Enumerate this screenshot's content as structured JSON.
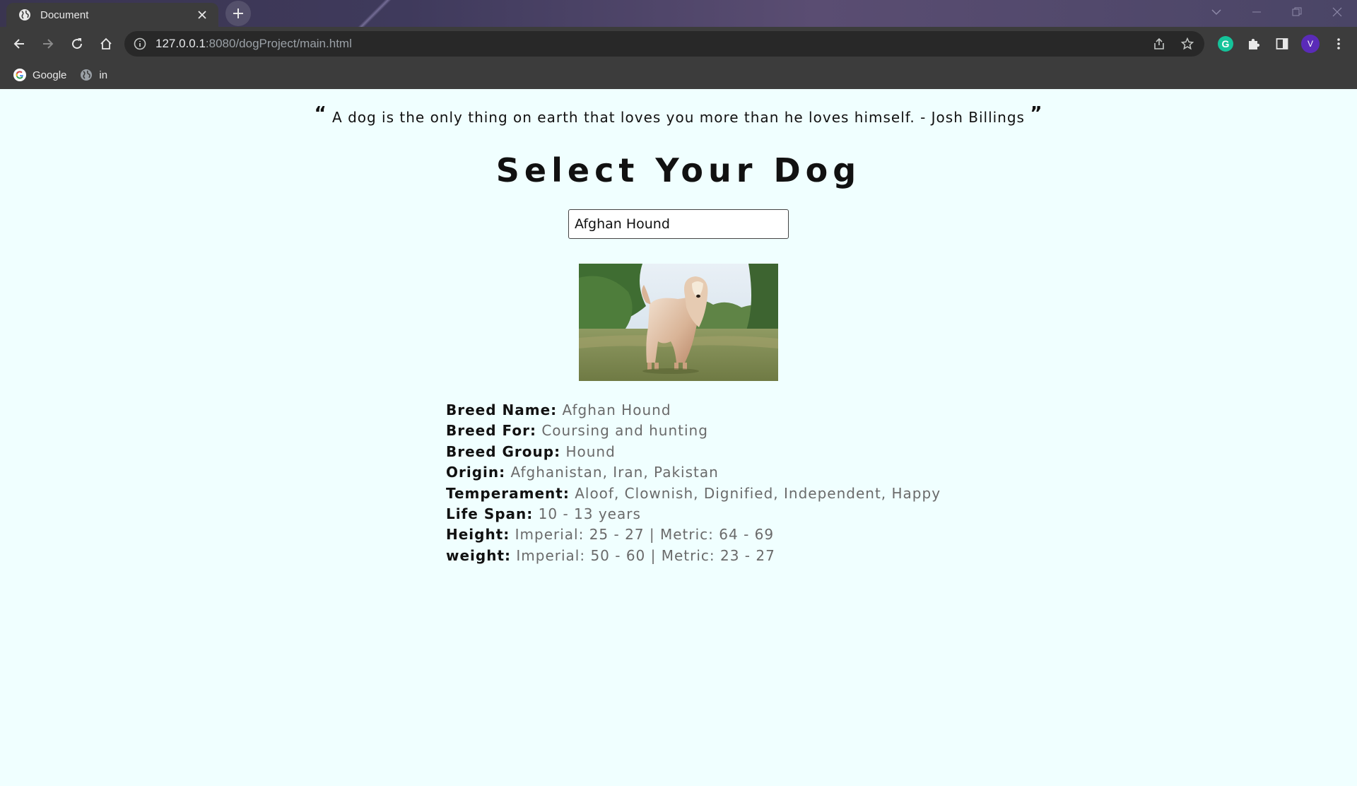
{
  "browser": {
    "tab_title": "Document",
    "url_host": "127.0.0.1",
    "url_rest": ":8080/dogProject/main.html",
    "profile_initial": "V",
    "grammarly_letter": "G",
    "bookmarks": [
      {
        "label": "Google",
        "icon": "google-icon"
      },
      {
        "label": "in",
        "icon": "globe-icon"
      }
    ]
  },
  "page": {
    "quote_open": "“",
    "quote_text": "A dog is the only thing on earth that loves you more than he loves himself. - Josh Billings",
    "quote_close": "”",
    "heading": "Select Your Dog",
    "search_value": "Afghan Hound",
    "details": [
      {
        "label": "Breed Name:",
        "value": "Afghan Hound"
      },
      {
        "label": "Breed For:",
        "value": "Coursing and hunting"
      },
      {
        "label": "Breed Group:",
        "value": "Hound"
      },
      {
        "label": "Origin:",
        "value": "Afghanistan, Iran, Pakistan"
      },
      {
        "label": "Temperament:",
        "value": "Aloof, Clownish, Dignified, Independent, Happy"
      },
      {
        "label": "Life Span:",
        "value": "10 - 13 years"
      },
      {
        "label": "Height:",
        "value": "Imperial: 25 - 27 | Metric: 64 - 69"
      },
      {
        "label": "weight:",
        "value": "Imperial: 50 - 60 | Metric: 23 - 27"
      }
    ]
  },
  "colors": {
    "page_bg": "#f0ffff",
    "chrome_bg": "#3c3c3c",
    "value_text": "#6a6a6a"
  }
}
